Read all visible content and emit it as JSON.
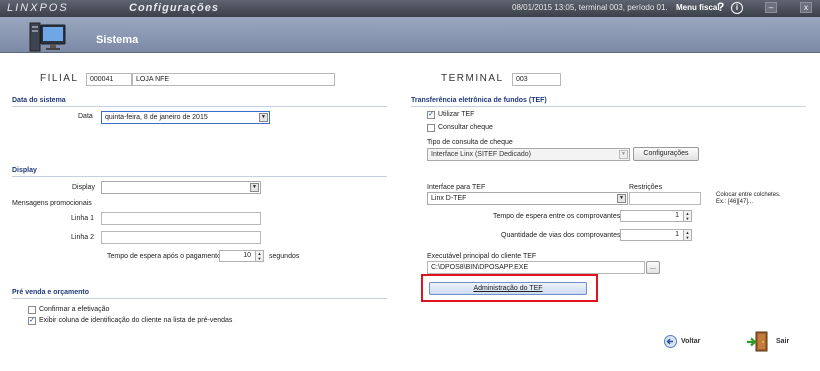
{
  "titlebar": {
    "logo": "LINXPOS",
    "section": "Configurações",
    "status": "08/01/2015 13:05, terminal 003, período 01.",
    "menu_fiscal": "Menu fiscal",
    "help_glyph": "?",
    "info_glyph": "i",
    "min_glyph": "–",
    "close_glyph": "x"
  },
  "header": {
    "title": "Sistema",
    "icon": "computer-icon"
  },
  "filial": {
    "label": "Filial",
    "code": "000041",
    "name": "LOJA NFE"
  },
  "terminal": {
    "label": "Terminal",
    "value": "003"
  },
  "data_sistema": {
    "section": "Data do sistema",
    "data_label": "Data",
    "data_value": "quinta-feira, 8 de janeiro de 2015"
  },
  "display": {
    "section": "Display",
    "display_label": "Display",
    "display_value": "",
    "mensagens": "Mensagens promocionais",
    "linha1_label": "Linha 1",
    "linha1_value": "",
    "linha2_label": "Linha 2",
    "linha2_value": "",
    "tempo_label": "Tempo de espera após o pagamento",
    "tempo_value": "10",
    "tempo_unit": "segundos"
  },
  "pre_venda": {
    "section": "Pré venda e orçamento",
    "confirmar_label": "Confirmar a efetivação",
    "confirmar_checked": false,
    "exibir_label": "Exibir coluna de identificação do cliente na lista de pré-vendas",
    "exibir_checked": true
  },
  "tef": {
    "section": "Transferência eletrônica de fundos (TEF)",
    "utilizar_label": "Utilizar TEF",
    "utilizar_checked": true,
    "consultar_label": "Consultar cheque",
    "consultar_checked": false,
    "tipo_label": "Tipo de consulta de cheque",
    "tipo_value": "Interface Linx (SITEF Dedicado)",
    "configuracoes_btn": "Configurações",
    "interface_label": "Interface para TEF",
    "interface_value": "Linx D-TEF",
    "restricoes_label": "Restrições",
    "restricoes_value": "",
    "colchetes_hint": "Colocar entre colchetes.",
    "colchetes_example": "Ex.: [46][47]...",
    "tempo_label": "Tempo de espera entre os comprovantes",
    "tempo_value": "1",
    "vias_label": "Quantidade de vias dos comprovantes",
    "vias_value": "1",
    "exec_label": "Executável principal do cliente TEF",
    "exec_value": "C:\\DPOS8\\BIN\\DPOSAPP.EXE",
    "browse_btn": "...",
    "admin_btn": "Administração do TEF"
  },
  "footer": {
    "voltar": "Voltar",
    "sair": "Sair"
  },
  "colors": {
    "section": "#1f3a7a",
    "highlight": "#e0141e",
    "header": "#8a97b2"
  }
}
